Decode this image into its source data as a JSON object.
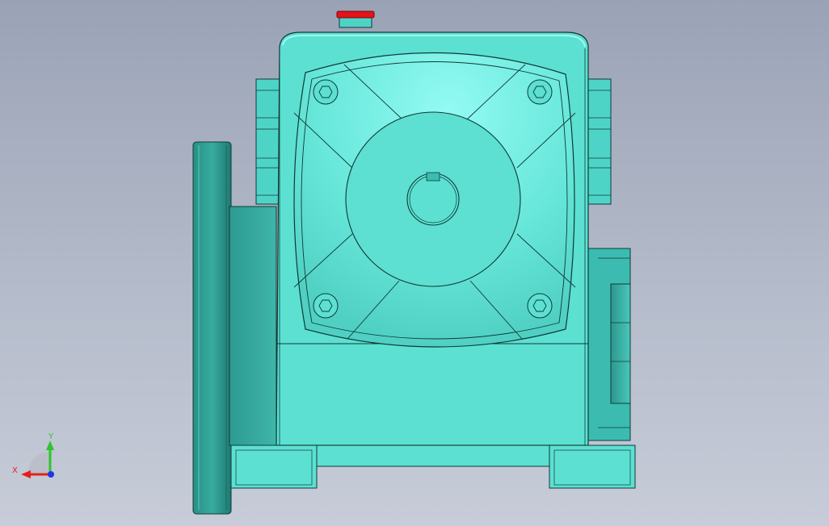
{
  "viewport": {
    "background_top": "#9aa3b6",
    "background_bottom": "#c7ccd8"
  },
  "model": {
    "body_color": "#5ce0d2",
    "highlight_color": "#8ff6ee",
    "shade_color": "#2f9c92",
    "dark_color": "#237d75",
    "edge_color": "#0f3a36",
    "vent_plug_color": "#e3141c"
  },
  "triad": {
    "x_label": "X",
    "y_label": "Y",
    "x_color": "#e2211c",
    "y_color": "#2ec42e",
    "z_color": "#2233ee"
  }
}
